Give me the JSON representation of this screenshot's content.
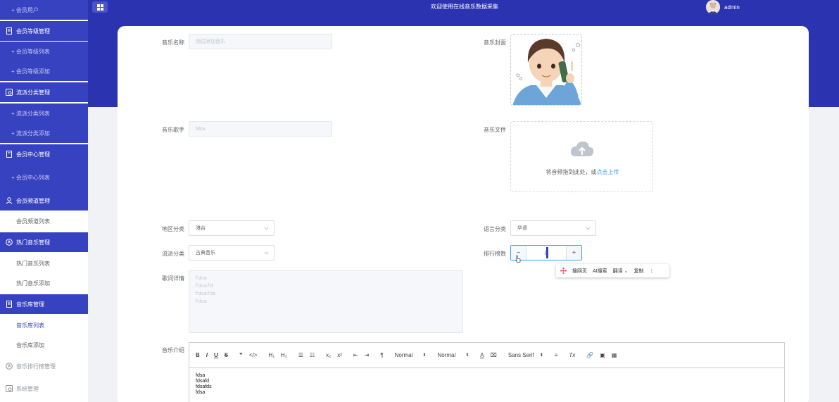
{
  "header": {
    "title": "欢迎使用在线音乐数据采集",
    "user": "admin"
  },
  "sidebar": {
    "items": [
      {
        "label": "会员用户",
        "kind": "sub",
        "top": 0
      },
      {
        "label": "会员等级管理",
        "kind": "head",
        "icon": "document-icon"
      },
      {
        "label": "会员等级列表",
        "kind": "sub"
      },
      {
        "label": "会员等级添加",
        "kind": "sub"
      },
      {
        "label": "流派分类管理",
        "kind": "head",
        "icon": "category-icon"
      },
      {
        "label": "流派分类列表",
        "kind": "sub"
      },
      {
        "label": "流派分类添加",
        "kind": "sub"
      },
      {
        "label": "会员中心管理",
        "kind": "head",
        "icon": "document-icon"
      },
      {
        "label": "会员中心列表",
        "kind": "sub"
      },
      {
        "label": "会员频道管理",
        "kind": "head",
        "icon": "user-icon"
      },
      {
        "label": "会员频道列表",
        "kind": "white-sub"
      },
      {
        "label": "热门音乐管理",
        "kind": "head",
        "icon": "music-icon"
      },
      {
        "label": "热门音乐列表",
        "kind": "white-sub"
      },
      {
        "label": "热门音乐添加",
        "kind": "white-sub"
      },
      {
        "label": "音乐库管理",
        "kind": "head",
        "icon": "document-icon"
      },
      {
        "label": "音乐库列表",
        "kind": "white-sub",
        "active": true
      },
      {
        "label": "音乐库添加",
        "kind": "white-sub"
      },
      {
        "label": "音乐排行榜管理",
        "kind": "white-head",
        "icon": "music-icon"
      },
      {
        "label": "系统管理",
        "kind": "white-head",
        "icon": "category-icon"
      }
    ]
  },
  "form": {
    "music_name_label": "音乐名称",
    "music_name_value": "测试添加音乐",
    "singer_label": "音乐歌手",
    "singer_value": "fdsa",
    "cover_label": "音乐封面",
    "file_label": "音乐文件",
    "upload_text": "将音频拖到此处，或",
    "upload_link": "点击上传",
    "region_label": "地区分类",
    "region_value": "港台",
    "language_label": "语言分类",
    "language_value": "华语",
    "genre_label": "流派分类",
    "genre_value": "古典音乐",
    "rank_label": "排行榜数",
    "rank_value": "0",
    "lyrics_label": "歌词详情",
    "lyrics_lines": [
      "fdsa",
      "fdsafd",
      "fdsafds",
      "fdsa"
    ],
    "intro_label": "音乐介绍",
    "intro_lines": [
      "fdsa",
      "fdsafd",
      "fdsafds",
      "fdsa"
    ]
  },
  "popup": {
    "items": [
      "搜网页",
      "AI搜索",
      "翻译 ⌄",
      "复制",
      "⋮"
    ]
  },
  "editor_toolbar": {
    "buttons": [
      "B",
      "I",
      "U",
      "S",
      "❞",
      "</>",
      "H₁",
      "H₂",
      "☰",
      "☷",
      "x₂",
      "x²",
      "⇤",
      "⇥",
      "¶"
    ],
    "selects": [
      "Normal",
      "Normal",
      "Sans Serif"
    ],
    "tail": [
      "A",
      "⌧",
      "≡",
      "Tx",
      "🔗",
      "▣",
      "▦"
    ]
  },
  "colors": {
    "primary": "#3742c0",
    "header": "#2c33b0",
    "link": "#409eff"
  }
}
